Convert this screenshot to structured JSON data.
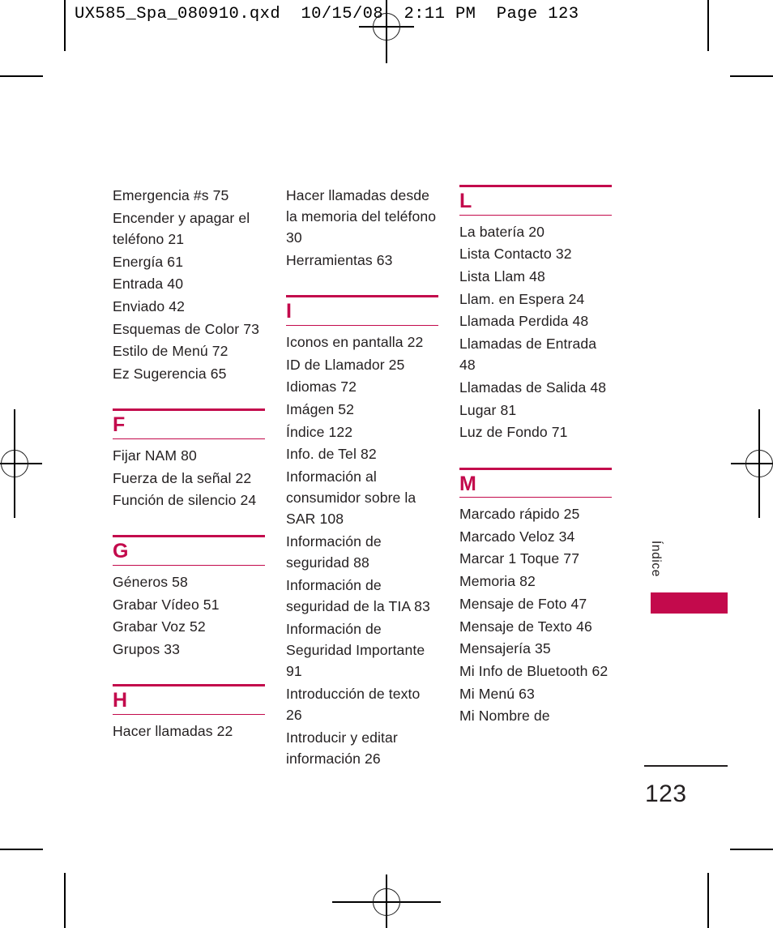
{
  "proof_slug": "UX585_Spa_080910.qxd  10/15/08  2:11 PM  Page 123",
  "side_tab": {
    "label": "Índice",
    "swatch_color": "#c30a4c"
  },
  "folio": {
    "page_number": "123"
  },
  "accent_color": "#c30a4c",
  "text_color": "#231f20",
  "index": {
    "columns": [
      {
        "id": "column-1",
        "blocks": [
          {
            "type": "entries",
            "continuation": true,
            "entries": [
              "Emergencia #s 75",
              "Encender y apagar el teléfono 21",
              "Energía 61",
              "Entrada 40",
              "Enviado 42",
              "Esquemas de Color 73",
              "Estilo de Menú 72",
              "Ez Sugerencia 65"
            ]
          },
          {
            "type": "section",
            "letter": "F",
            "entries": [
              "Fijar NAM 80",
              "Fuerza de la señal 22",
              "Función de silencio 24"
            ]
          },
          {
            "type": "section",
            "letter": "G",
            "entries": [
              "Géneros 58",
              "Grabar Vídeo 51",
              "Grabar Voz 52",
              "Grupos 33"
            ]
          },
          {
            "type": "section",
            "letter": "H",
            "entries": [
              "Hacer llamadas 22"
            ]
          }
        ]
      },
      {
        "id": "column-2",
        "blocks": [
          {
            "type": "entries",
            "continuation": true,
            "entries": [
              "Hacer llamadas desde la memoria del teléfono 30",
              "Herramientas 63"
            ]
          },
          {
            "type": "section",
            "letter": "I",
            "entries": [
              "Iconos en pantalla 22",
              "ID de Llamador 25",
              "Idiomas 72",
              "Imágen 52",
              "Índice 122",
              "Info. de Tel 82",
              "Información al consumidor sobre la SAR 108",
              "Información de seguridad 88",
              "Información de seguridad de la TIA 83",
              "Información de Seguridad Importante 91",
              "Introducción de texto 26",
              "Introducir y editar información 26"
            ]
          }
        ]
      },
      {
        "id": "column-3",
        "blocks": [
          {
            "type": "section",
            "letter": "L",
            "first_in_column": true,
            "entries": [
              "La batería 20",
              "Lista Contacto 32",
              "Lista Llam 48",
              "Llam. en Espera 24",
              "Llamada Perdida 48",
              "Llamadas de Entrada 48",
              "Llamadas de Salida 48",
              "Lugar 81",
              "Luz de Fondo 71"
            ]
          },
          {
            "type": "section",
            "letter": "M",
            "entries": [
              "Marcado rápido 25",
              "Marcado Veloz 34",
              "Marcar 1 Toque 77",
              "Memoria 82",
              "Mensaje de Foto 47",
              "Mensaje de Texto 46",
              "Mensajería 35",
              "Mi Info de Bluetooth 62",
              "Mi Menú 63",
              "Mi Nombre de"
            ]
          }
        ]
      }
    ]
  }
}
